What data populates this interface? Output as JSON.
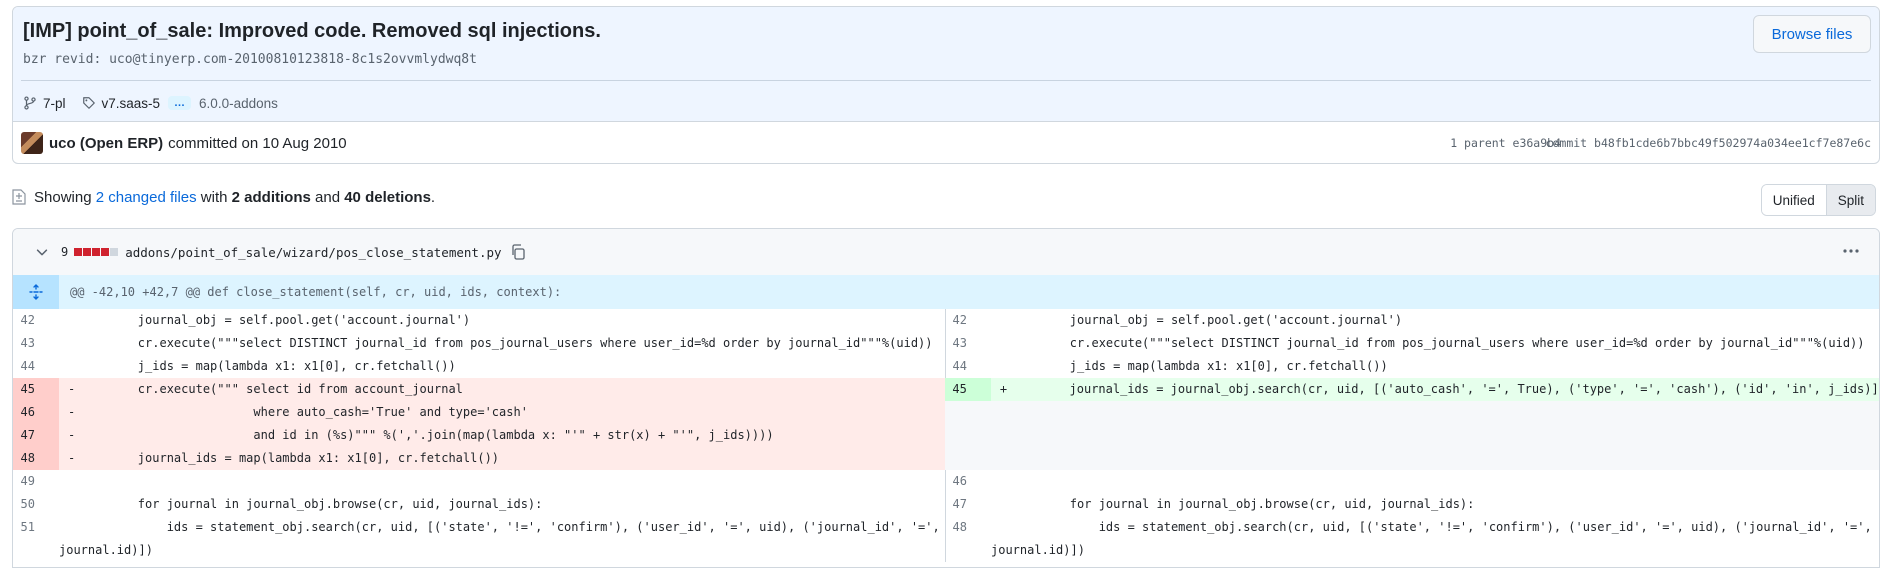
{
  "commit": {
    "title": "[IMP] point_of_sale: Improved code. Removed sql injections.",
    "description": "bzr revid: uco@tinyerp.com-20100810123818-8c1s2ovvmlydwq8t",
    "browse_button": "Browse files",
    "branch": "7-pl",
    "tag": "v7.saas-5",
    "more_tags": "…",
    "extra_tag": "6.0.0-addons",
    "author": "uco (Open ERP)",
    "committed_text": "committed on 10 Aug 2010",
    "parent_label": "1 parent",
    "parent_hash": "e36a9b4",
    "commit_label": "commit",
    "commit_hash": "b48fb1cde6b7bbc49f502974a034ee1cf7e87e6c"
  },
  "summary": {
    "showing": "Showing",
    "changed_files": "2 changed files",
    "with": "with",
    "additions": "2 additions",
    "and": "and",
    "deletions": "40 deletions",
    "period": "."
  },
  "view_toggle": {
    "unified": "Unified",
    "split": "Split"
  },
  "file": {
    "changes": "9",
    "path": "addons/point_of_sale/wizard/pos_close_statement.py",
    "hunk": "@@ -42,10 +42,7 @@ def close_statement(self, cr, uid, ids, context):"
  },
  "line_numbers": {
    "left": [
      "42",
      "43",
      "44",
      "45",
      "46",
      "47",
      "48",
      "49",
      "50",
      "51"
    ],
    "right": [
      "42",
      "43",
      "44",
      "45",
      "46",
      "47",
      "48"
    ]
  },
  "code": {
    "l42": "        journal_obj = self.pool.get('account.journal')",
    "l43": "        cr.execute(\"\"\"select DISTINCT journal_id from pos_journal_users where user_id=%d order by journal_id\"\"\"%(uid))",
    "l44": "        j_ids = map(lambda x1: x1[0], cr.fetchall())",
    "l45": "        cr.execute(\"\"\" select id from account_journal",
    "l46": "                        where auto_cash='True' and type='cash'",
    "l47": "                        and id in (%s)\"\"\" %(','.join(map(lambda x: \"'\" + str(x) + \"'\", j_ids))))",
    "l48": "        journal_ids = map(lambda x1: x1[0], cr.fetchall())",
    "l49": "",
    "l50": "        for journal in journal_obj.browse(cr, uid, journal_ids):",
    "l51": "            ids = statement_obj.search(cr, uid, [('state', '!=', 'confirm'), ('user_id', '=', uid), ('journal_id', '=',",
    "l51b": "journal.id)])",
    "r45": "        journal_ids = journal_obj.search(cr, uid, [('auto_cash', '=', True), ('type', '=', 'cash'), ('id', 'in', j_ids)])",
    "del_sign": "-",
    "add_sign": "+"
  },
  "colors": {
    "deletion": "#cf222e",
    "addition_bg": "#e6ffec",
    "deletion_bg": "#ffebe9",
    "link": "#0969da"
  },
  "icons": [
    "git-branch-icon",
    "tag-icon",
    "file-diff-icon",
    "chevron-down-icon",
    "copy-icon",
    "kebab-horizontal-icon",
    "unfold-icon"
  ]
}
